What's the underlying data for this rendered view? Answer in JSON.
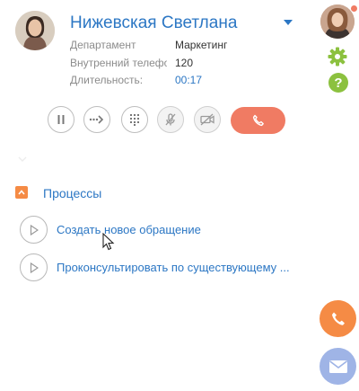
{
  "contact": {
    "name": "Нижевская Светлана",
    "fields": [
      {
        "label": "Департамент",
        "value": "Маркетинг"
      },
      {
        "label": "Внутренний телефон",
        "value": "120"
      },
      {
        "label": "Длительность:",
        "value": "00:17"
      }
    ]
  },
  "call_controls": [
    {
      "icon": "pause-icon"
    },
    {
      "icon": "transfer-icon"
    },
    {
      "icon": "dialpad-icon"
    },
    {
      "icon": "mute-microphone-icon"
    },
    {
      "icon": "video-off-icon"
    },
    {
      "icon": "hangup-icon"
    }
  ],
  "processes": {
    "title": "Процессы",
    "items": [
      {
        "label": "Создать новое обращение"
      },
      {
        "label": "Проконсультировать по существующему ..."
      }
    ]
  },
  "colors": {
    "accent_blue": "#2c77c4",
    "hangup": "#f07b63",
    "orange": "#f58b45",
    "green": "#8cc13f",
    "mail": "#9fb4e6"
  }
}
